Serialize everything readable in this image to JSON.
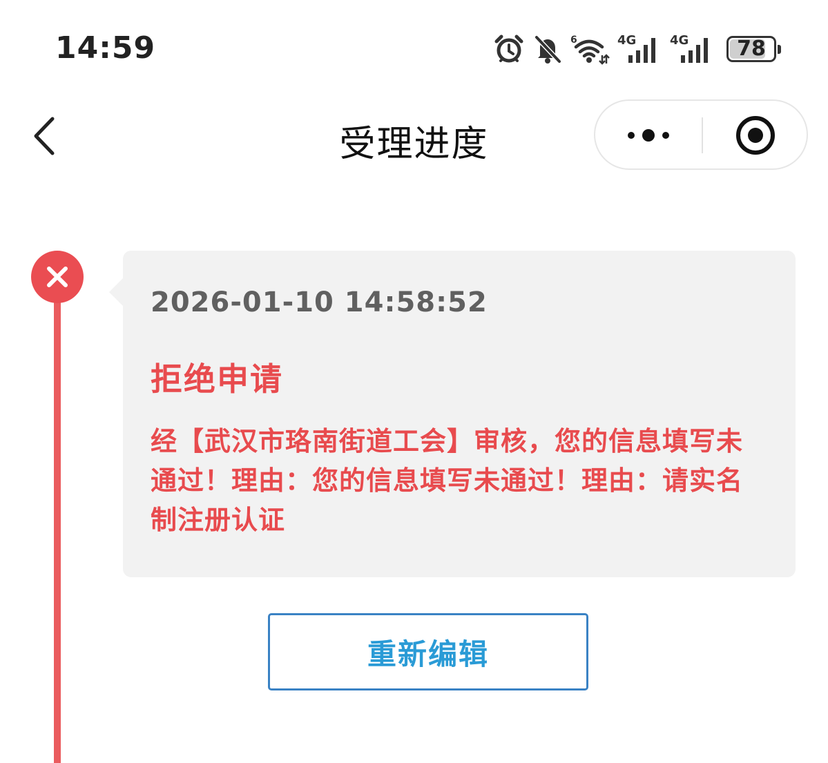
{
  "status_bar": {
    "time": "14:59",
    "icons": [
      "alarm-icon",
      "muted-bell-icon",
      "wifi-6-icon",
      "signal-4g-icon",
      "signal-4g-icon"
    ],
    "battery_level": "78",
    "wifi_badge": "6",
    "network_label_1": "4G",
    "network_label_2": "4G"
  },
  "nav": {
    "title": "受理进度",
    "back_icon": "chevron-left-icon",
    "more_icon": "more-dots-icon",
    "close_icon": "target-close-icon"
  },
  "timeline": {
    "status_icon": "close-x-icon",
    "accent_color": "#ea4d52"
  },
  "card": {
    "time": "2026-01-10 14:58:52",
    "status": "拒绝申请",
    "message": "经【武汉市珞南街道工会】审核，您的信息填写未通过！理由：您的信息填写未通过！理由：请实名制注册认证",
    "status_color": "#e84b4e"
  },
  "actions": {
    "reedit_label": "重新编辑",
    "reedit_border_color": "#3a82c4",
    "reedit_text_color": "#2a9bd6"
  }
}
